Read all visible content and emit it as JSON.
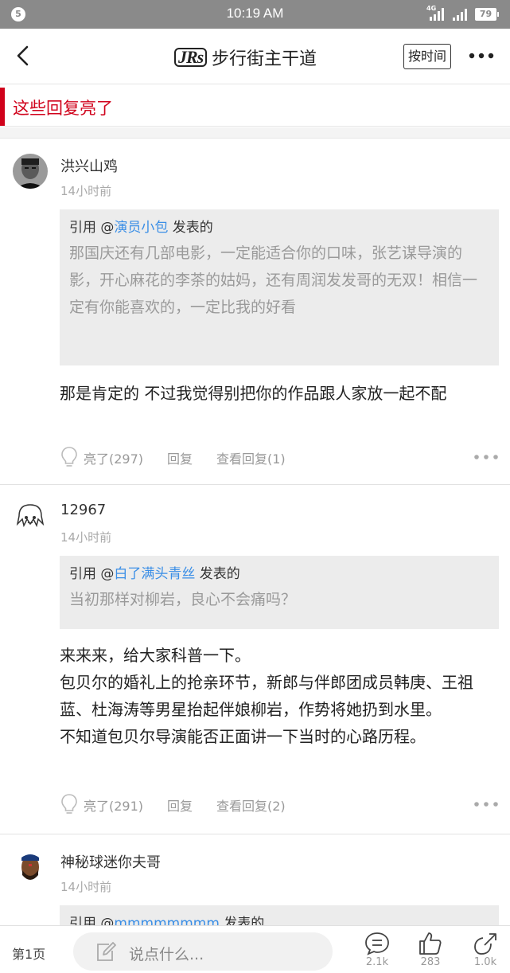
{
  "status_bar": {
    "notification": "5",
    "time": "10:19 AM",
    "network": "4G",
    "battery": "79"
  },
  "header": {
    "logo": "JRs",
    "title": "步行街主干道",
    "sort_button": "按时间"
  },
  "section": {
    "label": "这些回复亮了"
  },
  "comments": [
    {
      "username": "洪兴山鸡",
      "time": "14小时前",
      "quote": {
        "prefix": "引用 @",
        "author": "演员小包",
        "suffix": " 发表的",
        "text": "那国庆还有几部电影，一定能适合你的口味，张艺谋导演的影，开心麻花的李茶的姑妈，还有周润发发哥的无双！相信一定有你能喜欢的，一定比我的好看"
      },
      "text": "那是肯定的 不过我觉得别把你的作品跟人家放一起不配",
      "likes": "亮了(297)",
      "reply": "回复",
      "view_replies": "查看回复(1)"
    },
    {
      "username": "12967",
      "time": "14小时前",
      "quote": {
        "prefix": "引用 @",
        "author": "白了满头青丝",
        "suffix": " 发表的",
        "text": "当初那样对柳岩，良心不会痛吗？"
      },
      "text_lines": [
        "来来来，给大家科普一下。",
        "包贝尔的婚礼上的抢亲环节，新郎与伴郎团成员韩庚、王祖蓝、杜海涛等男星抬起伴娘柳岩，作势将她扔到水里。",
        "不知道包贝尔导演能否正面讲一下当时的心路历程。"
      ],
      "likes": "亮了(291)",
      "reply": "回复",
      "view_replies": "查看回复(2)"
    },
    {
      "username": "神秘球迷你夫哥",
      "time": "14小时前",
      "quote": {
        "prefix": "引用 @",
        "author": "mmmmmmmm",
        "suffix": " 发表的"
      }
    }
  ],
  "bottom_bar": {
    "page": "第1页",
    "placeholder": "说点什么...",
    "comments_count": "2.1k",
    "likes_count": "283",
    "shares_count": "1.0k"
  },
  "colors": {
    "accent_red": "#d0021b",
    "link_blue": "#3a8ee6",
    "status_bar": "#8a8a8a"
  },
  "icons": [
    "back-arrow-icon",
    "more-icon",
    "bulb-icon",
    "pencil-icon",
    "comment-icon",
    "thumbs-up-icon",
    "share-icon"
  ]
}
